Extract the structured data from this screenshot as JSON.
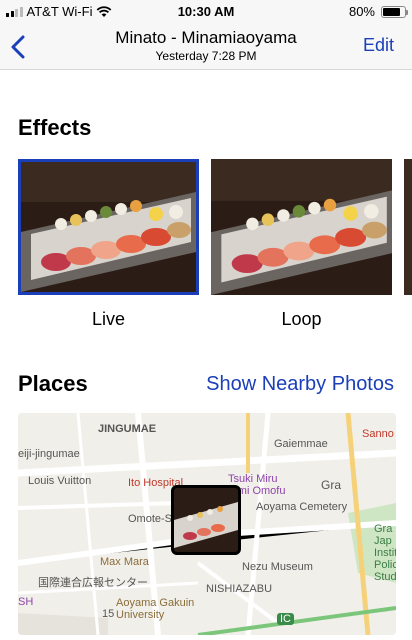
{
  "status_bar": {
    "carrier": "AT&T Wi-Fi",
    "time": "10:30 AM",
    "battery": "80%",
    "battery_level": 0.8
  },
  "nav": {
    "title": "Minato - Minamiaoyama",
    "subtitle": "Yesterday  7:28 PM",
    "edit_label": "Edit"
  },
  "effects": {
    "title": "Effects",
    "items": [
      {
        "label": "Live",
        "selected": true
      },
      {
        "label": "Loop",
        "selected": false
      }
    ]
  },
  "places": {
    "title": "Places",
    "link": "Show Nearby Photos",
    "map_labels": {
      "gaiemmae": "Gaiemmae",
      "jingumae": "JINGUMAE",
      "meiji": "eiji-jingumae",
      "sanno": "Sanno",
      "louis": "Louis Vuitton",
      "ito": "Ito Hospital",
      "tsukimiru1": "Tsuki Miru",
      "tsukimiru2": "Kimi Omofu",
      "gra": "Gra",
      "aoyama_cem": "Aoyama Cemetery",
      "omote": "Omote-S",
      "maxmara": "Max Mara",
      "nezu": "Nezu Museum",
      "kokusai": "国際連合広報センター",
      "sh": "SH",
      "nishiazabu": "NISHIAZABU",
      "agu1": "Aoyama Gakuin",
      "agu2": "University",
      "num15": "15",
      "ic": "IC",
      "side1": "Gra",
      "side2": "Jap",
      "side3": "Instit",
      "side4": "Polic",
      "side5": "Studi"
    }
  },
  "colors": {
    "accent": "#1a3fb8",
    "selection_border": "#1a3fb8"
  }
}
